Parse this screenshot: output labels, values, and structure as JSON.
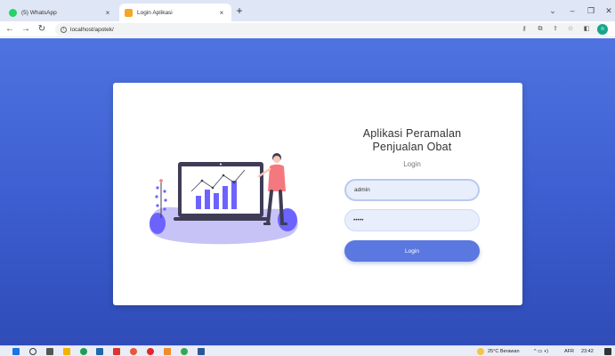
{
  "browser": {
    "tabs": [
      {
        "title": "(5) WhatsApp",
        "active": false,
        "icon": "whatsapp-icon"
      },
      {
        "title": "Login Aplikasi",
        "active": true,
        "icon": "app-favicon-icon"
      }
    ],
    "address": "localhost/apotek/",
    "profile_initial": "n",
    "new_tab_glyph": "+",
    "close_glyph": "×"
  },
  "login": {
    "app_title_line1": "Aplikasi Peramalan",
    "app_title_line2": "Penjualan Obat",
    "subtitle": "Login",
    "username_value": "admin",
    "password_value": "•••••",
    "button_label": "Login"
  },
  "taskbar": {
    "weather": "25°C  Berawan",
    "language": "AFR",
    "time": "23:42"
  },
  "colors": {
    "accent": "#5a78df",
    "background_top": "#4f73e0",
    "background_bottom": "#2f4cb8",
    "illustration_purple": "#6c63ff",
    "illustration_coral": "#f4797f"
  }
}
